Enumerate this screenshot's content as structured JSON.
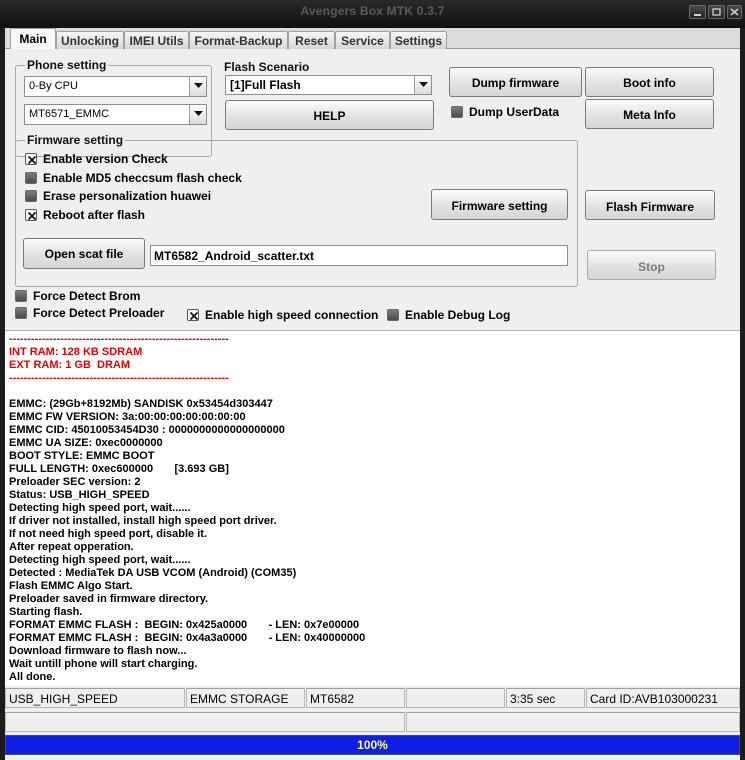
{
  "window": {
    "title": "Avengers Box MTK 0.3.7",
    "controls": [
      "minimize-icon",
      "maximize-icon",
      "close-icon"
    ]
  },
  "tabs": [
    {
      "label": "Main",
      "active": true
    },
    {
      "label": "Unlocking"
    },
    {
      "label": "IMEI Utils"
    },
    {
      "label": "Format-Backup"
    },
    {
      "label": "Reset"
    },
    {
      "label": "Service"
    },
    {
      "label": "Settings"
    }
  ],
  "phone_setting": {
    "title": "Phone setting",
    "cpu_value": "0-By CPU",
    "model_value": "MT6571_EMMC"
  },
  "flash_scenario": {
    "title": "Flash Scenario",
    "value": "[1]Full Flash"
  },
  "buttons": {
    "help": "HELP",
    "dump_firmware": "Dump firmware",
    "boot_info": "Boot info",
    "meta_info": "Meta Info",
    "firmware_setting": "Firmware setting",
    "flash_firmware": "Flash Firmware",
    "open_scat": "Open scat file",
    "stop": "Stop"
  },
  "dump_userdata": {
    "label": "Dump UserData",
    "checked": false
  },
  "firmware_setting": {
    "title": "Firmware setting",
    "options": [
      {
        "label": "Enable version Check",
        "checked": true
      },
      {
        "label": "Enable MD5 checcsum flash check",
        "checked": false
      },
      {
        "label": "Erase personalization huawei",
        "checked": false
      },
      {
        "label": "Reboot after flash",
        "checked": true
      }
    ],
    "scatter_file": "MT6582_Android_scatter.txt"
  },
  "bottom_options": {
    "force_detect_brom": {
      "label": "Force Detect Brom",
      "checked": false
    },
    "force_detect_preloader": {
      "label": "Force Detect Preloader",
      "checked": false
    },
    "high_speed": {
      "label": "Enable high speed connection",
      "checked": true
    },
    "debug_log": {
      "label": "Enable Debug Log",
      "checked": false
    }
  },
  "log": [
    {
      "text": "------------------------------------------------------------",
      "color": "red"
    },
    {
      "text": "INT RAM: 128 KB SDRAM",
      "color": "red"
    },
    {
      "text": "EXT RAM: 1 GB  DRAM",
      "color": "red"
    },
    {
      "text": "------------------------------------------------------------",
      "color": "red"
    },
    {
      "text": ""
    },
    {
      "text": "EMMC: (29Gb+8192Mb) SANDISK 0x53454d303447"
    },
    {
      "text": "EMMC FW VERSION: 3a:00:00:00:00:00:00:00"
    },
    {
      "text": "EMMC CID: 45010053454D30 : 0000000000000000000"
    },
    {
      "text": "EMMC UA SIZE: 0xec0000000"
    },
    {
      "text": "BOOT STYLE: EMMC BOOT"
    },
    {
      "text": "FULL LENGTH: 0xec600000       [3.693 GB]"
    },
    {
      "text": "Preloader SEC version: 2"
    },
    {
      "text": "Status: USB_HIGH_SPEED"
    },
    {
      "text": "Detecting high speed port, wait......"
    },
    {
      "text": "If driver not installed, install high speed port driver."
    },
    {
      "text": "If not need high speed port, disable it."
    },
    {
      "text": "After repeat opperation."
    },
    {
      "text": "Detecting high speed port, wait......"
    },
    {
      "text": "Detected : MediaTek DA USB VCOM (Android) (COM35)"
    },
    {
      "text": "Flash EMMC Algo Start."
    },
    {
      "text": "Preloader saved in firmware directory."
    },
    {
      "text": "Starting flash."
    },
    {
      "text": "FORMAT EMMC FLASH :  BEGIN: 0x425a0000       - LEN: 0x7e00000"
    },
    {
      "text": "FORMAT EMMC FLASH :  BEGIN: 0x4a3a0000       - LEN: 0x40000000"
    },
    {
      "text": "Download firmware to flash now..."
    },
    {
      "text": "Wait untill phone will start charging."
    },
    {
      "text": "All done."
    }
  ],
  "status": {
    "usb": "USB_HIGH_SPEED",
    "storage": "EMMC STORAGE",
    "chip": "MT6582",
    "empty1": "",
    "time": "3:35 sec",
    "card_id": "Card ID:AVB103000231"
  },
  "progress": {
    "text": "100%",
    "value": 1.0,
    "color": "#0f1fe6"
  }
}
